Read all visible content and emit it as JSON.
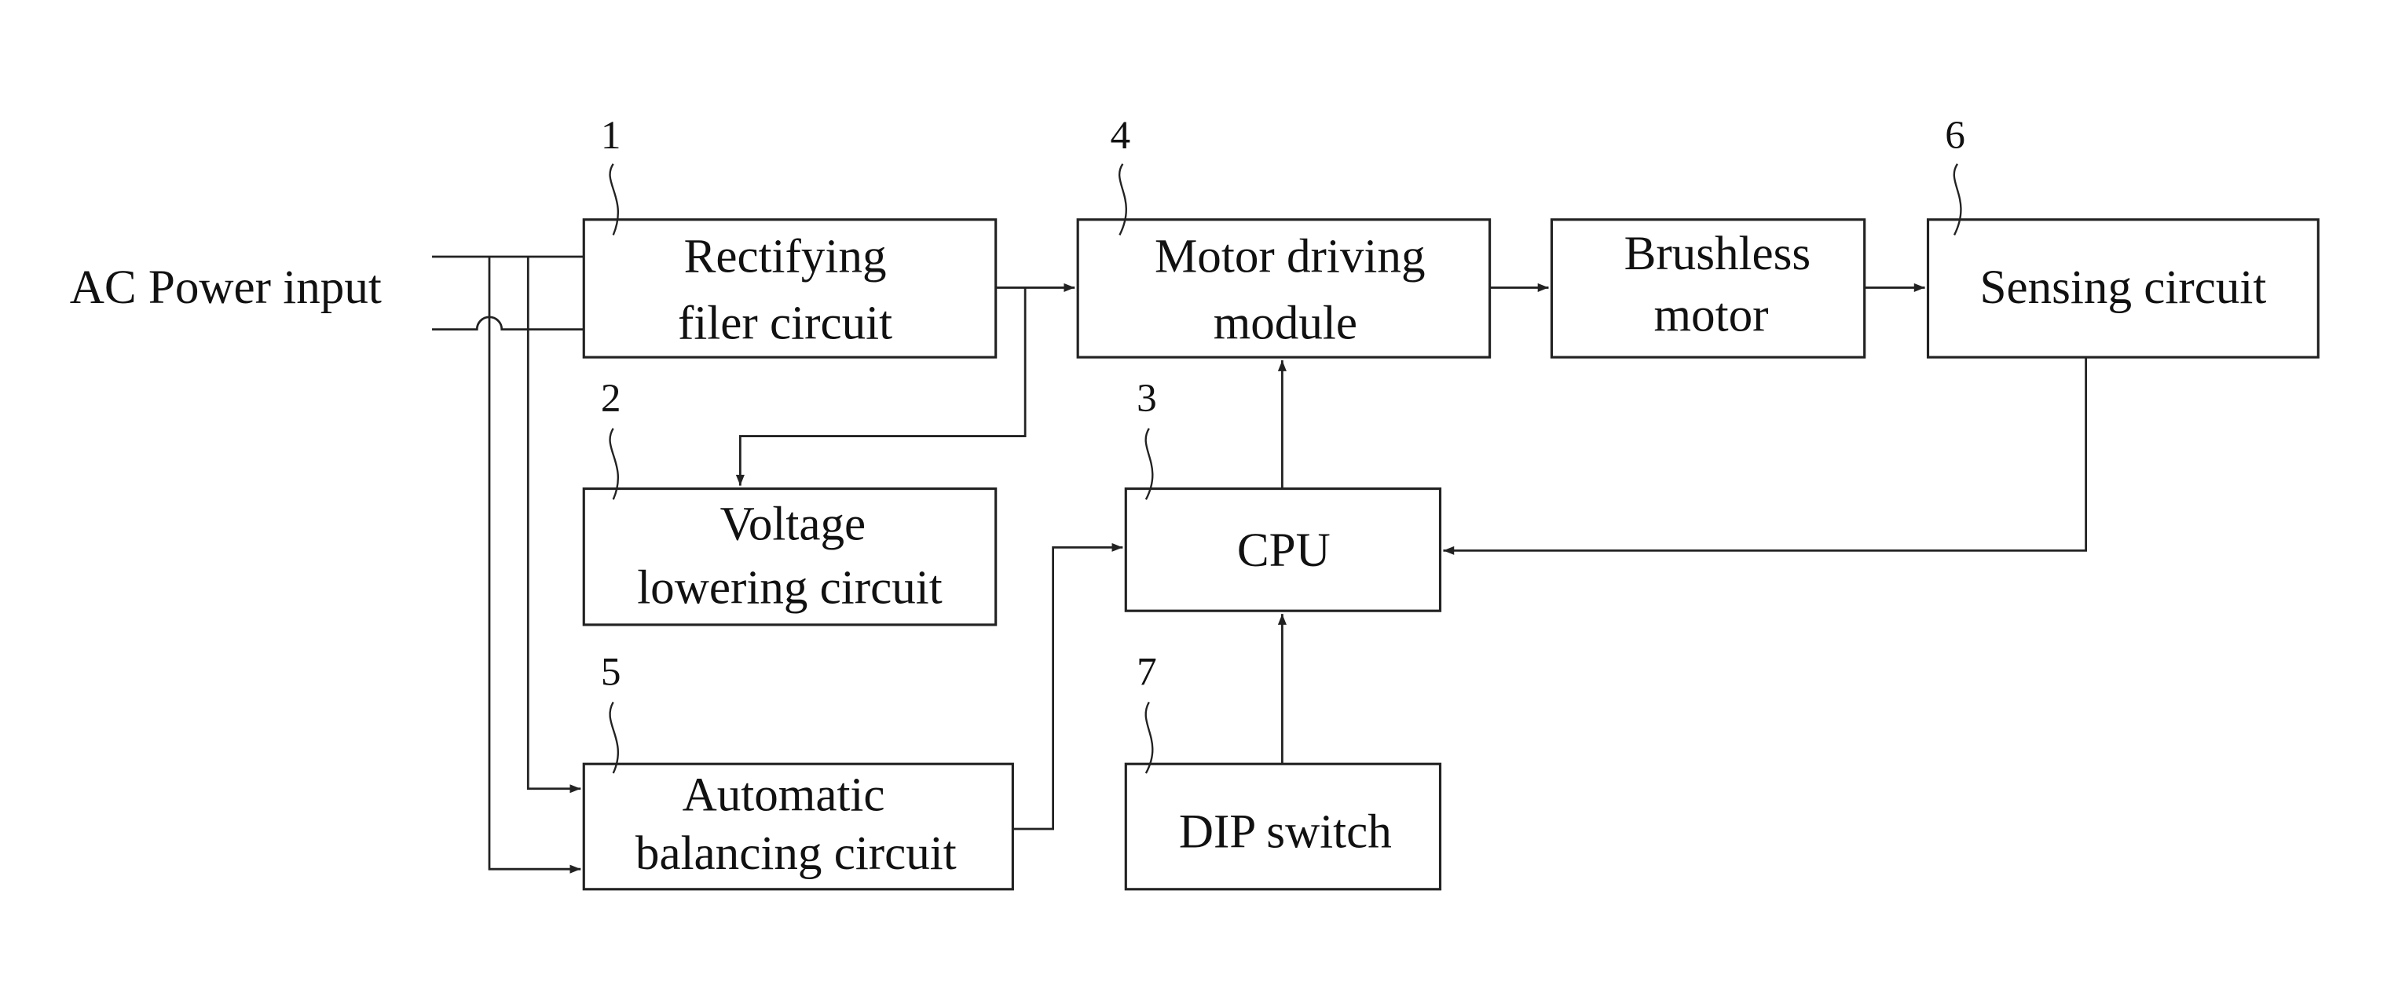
{
  "diagram": {
    "input_label": "AC Power input",
    "blocks": {
      "rectifying": {
        "ref": "1",
        "lines": [
          "Rectifying",
          "filer circuit"
        ]
      },
      "voltage_lowering": {
        "ref": "2",
        "lines": [
          "Voltage",
          "lowering circuit"
        ]
      },
      "cpu": {
        "ref": "3",
        "lines": [
          "CPU"
        ]
      },
      "motor_driving": {
        "ref": "4",
        "lines": [
          "Motor driving",
          "module"
        ]
      },
      "auto_balancing": {
        "ref": "5",
        "lines": [
          "Automatic",
          "balancing circuit"
        ]
      },
      "sensing": {
        "ref": "6",
        "lines": [
          "Sensing circuit"
        ]
      },
      "dip_switch": {
        "ref": "7",
        "lines": [
          "DIP switch"
        ]
      },
      "brushless_motor": {
        "ref": "",
        "lines": [
          "Brushless",
          "motor"
        ]
      }
    },
    "connections": [
      {
        "from": "AC Power input",
        "to": "Rectifying filer circuit"
      },
      {
        "from": "AC Power input",
        "to": "Automatic balancing circuit"
      },
      {
        "from": "Rectifying filer circuit",
        "to": "Motor driving module"
      },
      {
        "from": "Rectifying filer circuit",
        "to": "Voltage lowering circuit"
      },
      {
        "from": "Motor driving module",
        "to": "Brushless motor"
      },
      {
        "from": "Brushless motor",
        "to": "Sensing circuit"
      },
      {
        "from": "Sensing circuit",
        "to": "CPU"
      },
      {
        "from": "CPU",
        "to": "Motor driving module"
      },
      {
        "from": "Automatic balancing circuit",
        "to": "CPU"
      },
      {
        "from": "DIP switch",
        "to": "CPU"
      }
    ]
  }
}
